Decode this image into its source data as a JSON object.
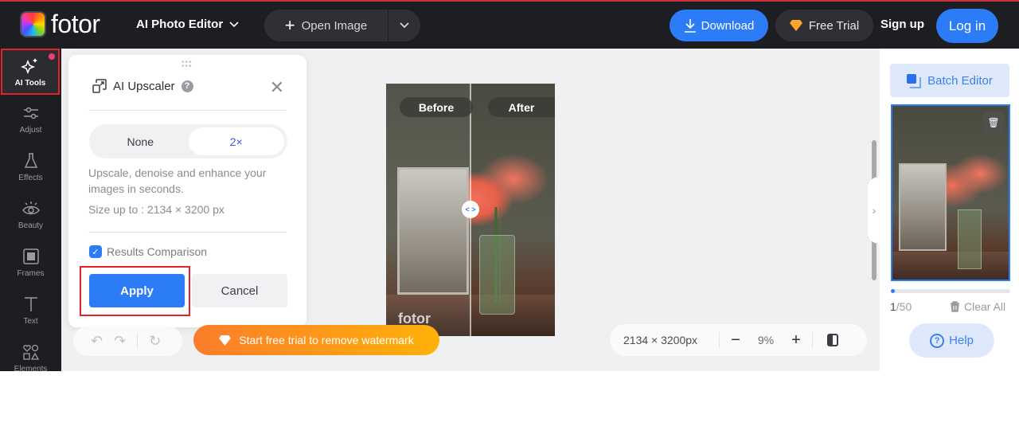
{
  "header": {
    "brand": "fotor",
    "editor_menu": "AI Photo Editor",
    "open_image": "Open Image",
    "download": "Download",
    "free_trial": "Free Trial",
    "sign_up": "Sign up",
    "log_in": "Log in"
  },
  "sidebar": {
    "items": [
      {
        "label": "AI Tools",
        "icon": "sparkle-icon",
        "active": true,
        "notification": true
      },
      {
        "label": "Adjust",
        "icon": "sliders-icon"
      },
      {
        "label": "Effects",
        "icon": "flask-icon"
      },
      {
        "label": "Beauty",
        "icon": "eye-icon"
      },
      {
        "label": "Frames",
        "icon": "frame-icon"
      },
      {
        "label": "Text",
        "icon": "text-icon"
      },
      {
        "label": "Elements",
        "icon": "shapes-icon"
      }
    ]
  },
  "panel": {
    "title": "AI Upscaler",
    "help": "?",
    "close": "✕",
    "options": [
      "None",
      "2×"
    ],
    "selected_option": "2×",
    "description": "Upscale, denoise and enhance your images in seconds.",
    "size_limit": "Size up to : 2134 × 3200 px",
    "comparison_label": "Results Comparison",
    "comparison_checked": true,
    "apply": "Apply",
    "cancel": "Cancel"
  },
  "canvas": {
    "before_label": "Before",
    "after_label": "After",
    "watermark": "fotor"
  },
  "bottom": {
    "promo": "Start free trial to remove watermark",
    "dimensions": "2134 × 3200px",
    "zoom": "9%",
    "zoom_out": "−",
    "zoom_in": "+"
  },
  "right_panel": {
    "batch_editor": "Batch Editor",
    "count_current": "1",
    "count_total": "/50",
    "progress_fraction": 0.02,
    "clear_all": "Clear All",
    "help": "Help"
  },
  "colors": {
    "accent": "#2b7cf6",
    "highlight": "#e8202a",
    "promo_start": "#fb7d2a",
    "promo_end": "#ffb10a"
  }
}
